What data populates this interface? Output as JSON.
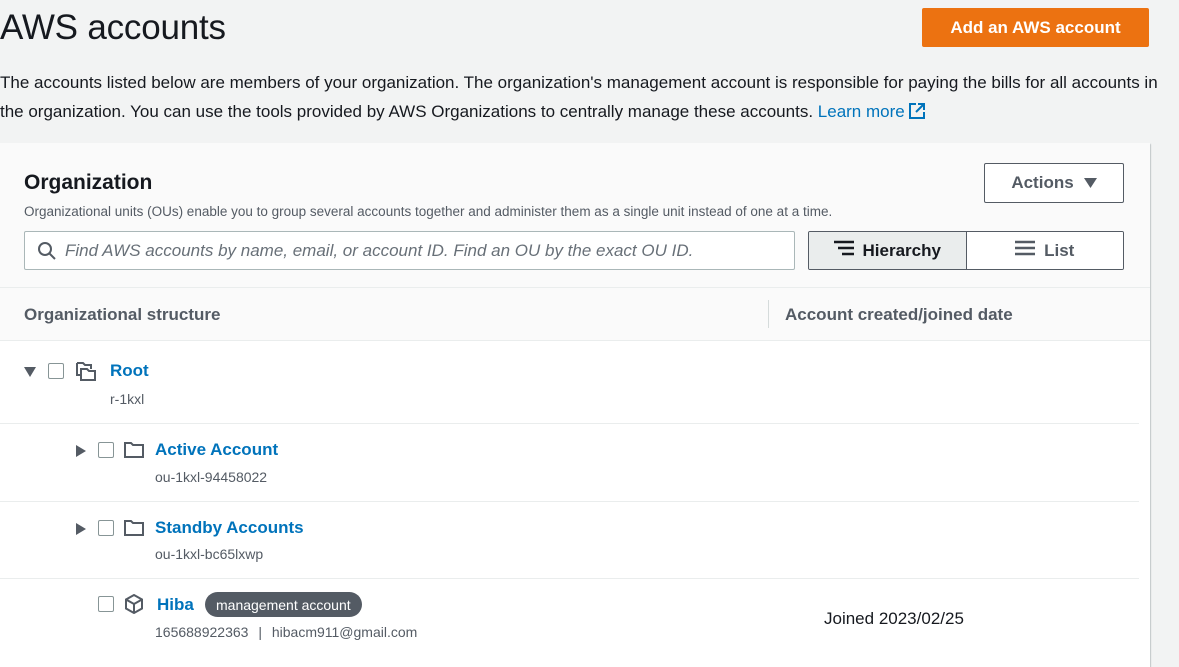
{
  "header": {
    "title": "AWS accounts",
    "add_button": "Add an AWS account",
    "intro_text": "The accounts listed below are members of your organization. The organization's management account is responsible for paying the bills for all accounts in the organization. You can use the tools provided by AWS Organizations to centrally manage these accounts.",
    "learn_more": "Learn more"
  },
  "organization": {
    "title": "Organization",
    "description": "Organizational units (OUs) enable you to group several accounts together and administer them as a single unit instead of one at a time.",
    "actions_label": "Actions",
    "search_placeholder": "Find AWS accounts by name, email, or account ID. Find an OU by the exact OU ID.",
    "view_toggle": {
      "hierarchy": "Hierarchy",
      "list": "List",
      "selected": "Hierarchy"
    }
  },
  "table": {
    "columns": [
      "Organizational structure",
      "Account created/joined date"
    ],
    "root": {
      "name": "Root",
      "id": "r-1kxl"
    },
    "ous": [
      {
        "name": "Active Account",
        "id": "ou-1kxl-94458022"
      },
      {
        "name": "Standby Accounts",
        "id": "ou-1kxl-bc65lxwp"
      }
    ],
    "account": {
      "name": "Hiba",
      "badge": "management account",
      "id": "165688922363",
      "separator": "|",
      "email": "hibacm911@gmail.com",
      "joined": "Joined 2023/02/25"
    }
  },
  "colors": {
    "primary_button": "#ec7211",
    "link": "#0073bb",
    "badge": "#545b64"
  }
}
